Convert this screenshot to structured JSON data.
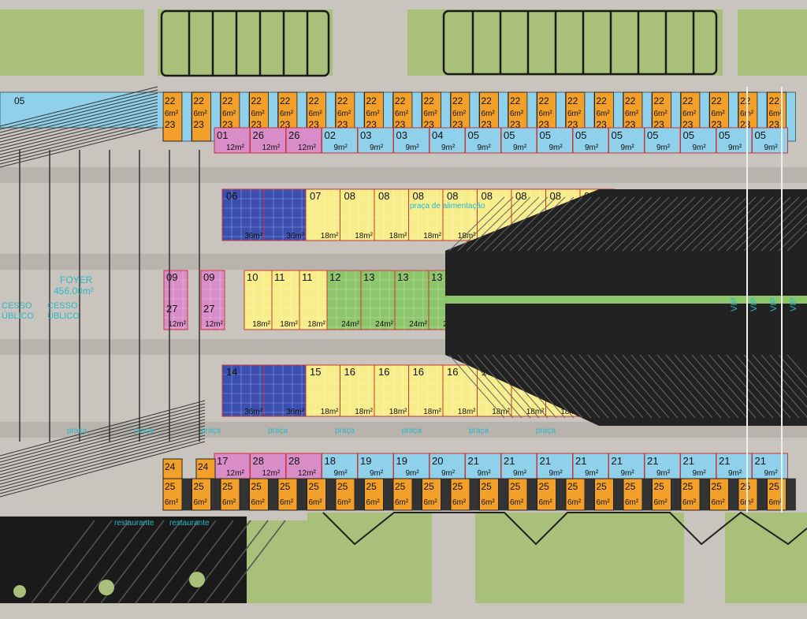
{
  "colors": {
    "ground": "#c9c4bd",
    "lawn": "#a9c07a",
    "orange": "#f3a02b",
    "cyan": "#8fd0ea",
    "pink": "#d88cc8",
    "yellow": "#f7ee8a",
    "blue": "#3a4fb0",
    "green": "#8cc56a",
    "wall": "#1a1a1a",
    "annot": "#2bb8c9"
  },
  "labels": {
    "foyer": "FOYER",
    "foyer_area": "456.00m²",
    "access1": "CESSO",
    "access2": "ÚBLICO",
    "restaurant": "restaurante",
    "vip": "VIP",
    "praca": "praça de alimentação",
    "row_num": "05"
  },
  "rows": {
    "top_orange": {
      "num": "22",
      "num2": "23",
      "area": "6m²",
      "count": 22
    },
    "top_small": [
      {
        "num": "01",
        "area": "12m²",
        "color": "pink"
      },
      {
        "num": "26",
        "area": "12m²",
        "color": "pink"
      },
      {
        "num": "26",
        "area": "12m²",
        "color": "pink"
      },
      {
        "num": "02",
        "area": "9m²",
        "color": "cyan"
      },
      {
        "num": "03",
        "area": "9m²",
        "color": "cyan"
      },
      {
        "num": "03",
        "area": "9m²",
        "color": "cyan"
      },
      {
        "num": "04",
        "area": "9m²",
        "color": "cyan"
      },
      {
        "num": "05",
        "area": "9m²",
        "color": "cyan"
      },
      {
        "num": "05",
        "area": "9m²",
        "color": "cyan"
      },
      {
        "num": "05",
        "area": "9m²",
        "color": "cyan"
      },
      {
        "num": "05",
        "area": "9m²",
        "color": "cyan"
      },
      {
        "num": "05",
        "area": "9m²",
        "color": "cyan"
      },
      {
        "num": "05",
        "area": "9m²",
        "color": "cyan"
      },
      {
        "num": "05",
        "area": "9m²",
        "color": "cyan"
      },
      {
        "num": "05",
        "area": "9m²",
        "color": "cyan"
      },
      {
        "num": "05",
        "area": "9m²",
        "color": "cyan"
      }
    ],
    "upper_big": [
      {
        "num": "06",
        "area": "36m²",
        "color": "blue"
      },
      {
        "num": "",
        "area": "36m²",
        "color": "blue"
      },
      {
        "num": "07",
        "area": "18m²",
        "color": "yellow"
      },
      {
        "num": "08",
        "area": "18m²",
        "color": "yellow"
      },
      {
        "num": "08",
        "area": "18m²",
        "color": "yellow"
      },
      {
        "num": "08",
        "area": "18m²",
        "color": "yellow"
      },
      {
        "num": "08",
        "area": "18m²",
        "color": "yellow"
      },
      {
        "num": "08",
        "area": "18m²",
        "color": "yellow"
      },
      {
        "num": "08",
        "area": "18m²",
        "color": "yellow"
      },
      {
        "num": "08",
        "area": "18m²",
        "color": "yellow"
      },
      {
        "num": "08",
        "area": "18m²",
        "color": "yellow"
      }
    ],
    "middle": [
      {
        "num": "09",
        "num2": "27",
        "area": "12m²",
        "color": "pink"
      },
      {
        "num": "09",
        "num2": "27",
        "area": "12m²",
        "color": "pink"
      },
      {
        "num": "10",
        "area": "18m²",
        "color": "yellow"
      },
      {
        "num": "11",
        "area": "18m²",
        "color": "yellow"
      },
      {
        "num": "11",
        "area": "18m²",
        "color": "yellow"
      },
      {
        "num": "12",
        "area": "24m²",
        "color": "green"
      },
      {
        "num": "13",
        "area": "24m²",
        "color": "green"
      },
      {
        "num": "13",
        "area": "24m²",
        "color": "green"
      },
      {
        "num": "13",
        "area": "24m²",
        "color": "green"
      }
    ],
    "lower_big": [
      {
        "num": "14",
        "area": "36m²",
        "color": "blue"
      },
      {
        "num": "",
        "area": "36m²",
        "color": "blue"
      },
      {
        "num": "15",
        "area": "18m²",
        "color": "yellow"
      },
      {
        "num": "16",
        "area": "18m²",
        "color": "yellow"
      },
      {
        "num": "16",
        "area": "18m²",
        "color": "yellow"
      },
      {
        "num": "16",
        "area": "18m²",
        "color": "yellow"
      },
      {
        "num": "16",
        "area": "18m²",
        "color": "yellow"
      },
      {
        "num": "16",
        "area": "18m²",
        "color": "yellow"
      },
      {
        "num": "16",
        "area": "18m²",
        "color": "yellow"
      },
      {
        "num": "16",
        "area": "18m²",
        "color": "yellow"
      }
    ],
    "bottom_small": [
      {
        "num": "17",
        "area": "12m²",
        "color": "pink"
      },
      {
        "num": "28",
        "area": "12m²",
        "color": "pink"
      },
      {
        "num": "28",
        "area": "12m²",
        "color": "pink"
      },
      {
        "num": "18",
        "area": "9m²",
        "color": "cyan"
      },
      {
        "num": "19",
        "area": "9m²",
        "color": "cyan"
      },
      {
        "num": "19",
        "area": "9m²",
        "color": "cyan"
      },
      {
        "num": "20",
        "area": "9m²",
        "color": "cyan"
      },
      {
        "num": "21",
        "area": "9m²",
        "color": "cyan"
      },
      {
        "num": "21",
        "area": "9m²",
        "color": "cyan"
      },
      {
        "num": "21",
        "area": "9m²",
        "color": "cyan"
      },
      {
        "num": "21",
        "area": "9m²",
        "color": "cyan"
      },
      {
        "num": "21",
        "area": "9m²",
        "color": "cyan"
      },
      {
        "num": "21",
        "area": "9m²",
        "color": "cyan"
      },
      {
        "num": "21",
        "area": "9m²",
        "color": "cyan"
      },
      {
        "num": "21",
        "area": "9m²",
        "color": "cyan"
      },
      {
        "num": "21",
        "area": "9m²",
        "color": "cyan"
      }
    ],
    "bottom_orange": {
      "num": "24",
      "num2": "25",
      "area": "6m²",
      "count": 22
    }
  }
}
